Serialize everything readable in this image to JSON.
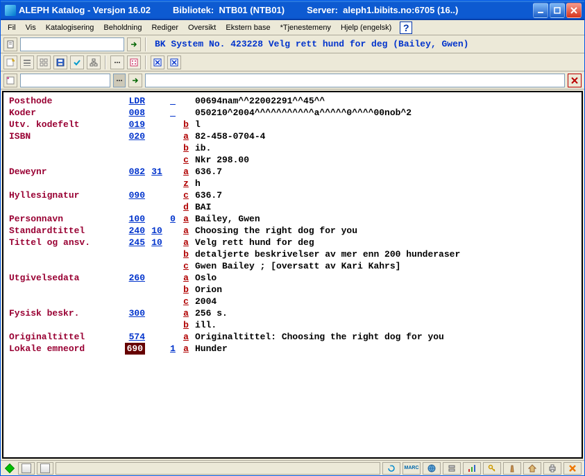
{
  "titlebar": {
    "app": "ALEPH Katalog - Versjon 16.02",
    "library_label": "Bibliotek:",
    "library_value": "NTB01 (NTB01)",
    "server_label": "Server:",
    "server_value": "aleph1.bibits.no:6705 (16..)"
  },
  "menu": {
    "fil": "Fil",
    "vis": "Vis",
    "katalogisering": "Katalogisering",
    "beholdning": "Beholdning",
    "rediger": "Rediger",
    "oversikt": "Oversikt",
    "eksternbase": "Ekstern base",
    "tjenestemeny": "*Tjenestemeny",
    "hjelp": "Hjelp (engelsk)"
  },
  "locbar": {
    "record_title": "BK System No. 423228 Velg rett hund for deg (Bailey, Gwen)"
  },
  "marc": [
    {
      "label": "Posthode",
      "tag": "LDR",
      "ind1": "",
      "ind2": "_",
      "sub": "",
      "val": "00694nam^^22002291^^45^^"
    },
    {
      "label": "Koder",
      "tag": "008",
      "ind1": "",
      "ind2": "_",
      "sub": "",
      "val": "050210^2004^^^^^^^^^^^a^^^^^0^^^^00nob^2"
    },
    {
      "label": "Utv. kodefelt",
      "tag": "019",
      "ind1": "",
      "ind2": "",
      "sub": "b",
      "val": "l"
    },
    {
      "label": "ISBN",
      "tag": "020",
      "ind1": "",
      "ind2": "",
      "sub": "a",
      "val": "82-458-0704-4"
    },
    {
      "label": "",
      "tag": "",
      "ind1": "",
      "ind2": "",
      "sub": "b",
      "val": "ib."
    },
    {
      "label": "",
      "tag": "",
      "ind1": "",
      "ind2": "",
      "sub": "c",
      "val": "Nkr 298.00"
    },
    {
      "label": "Deweynr",
      "tag": "082",
      "ind1": "31",
      "ind2": "",
      "sub": "a",
      "val": "636.7"
    },
    {
      "label": "",
      "tag": "",
      "ind1": "",
      "ind2": "",
      "sub": "z",
      "val": "h"
    },
    {
      "label": "Hyllesignatur",
      "tag": "090",
      "ind1": "",
      "ind2": "",
      "sub": "c",
      "val": "636.7"
    },
    {
      "label": "",
      "tag": "",
      "ind1": "",
      "ind2": "",
      "sub": "d",
      "val": "BAI"
    },
    {
      "label": "Personnavn",
      "tag": "100",
      "ind1": "",
      "ind2": "0",
      "sub": "a",
      "val": "Bailey, Gwen"
    },
    {
      "label": "Standardtittel",
      "tag": "240",
      "ind1": "10",
      "ind2": "",
      "sub": "a",
      "val": "Choosing the right dog for you"
    },
    {
      "label": "Tittel og ansv.",
      "tag": "245",
      "ind1": "10",
      "ind2": "",
      "sub": "a",
      "val": "Velg rett hund for deg"
    },
    {
      "label": "",
      "tag": "",
      "ind1": "",
      "ind2": "",
      "sub": "b",
      "val": "detaljerte beskrivelser av mer enn 200 hunderaser"
    },
    {
      "label": "",
      "tag": "",
      "ind1": "",
      "ind2": "",
      "sub": "c",
      "val": "Gwen Bailey ; [oversatt av Kari Kahrs]"
    },
    {
      "label": "Utgivelsedata",
      "tag": "260",
      "ind1": "",
      "ind2": "",
      "sub": "a",
      "val": "Oslo"
    },
    {
      "label": "",
      "tag": "",
      "ind1": "",
      "ind2": "",
      "sub": "b",
      "val": "Orion"
    },
    {
      "label": "",
      "tag": "",
      "ind1": "",
      "ind2": "",
      "sub": "c",
      "val": "2004"
    },
    {
      "label": "Fysisk beskr.",
      "tag": "300",
      "ind1": "",
      "ind2": "",
      "sub": "a",
      "val": "256 s."
    },
    {
      "label": "",
      "tag": "",
      "ind1": "",
      "ind2": "",
      "sub": "b",
      "val": "ill."
    },
    {
      "label": "Originaltittel",
      "tag": "574",
      "ind1": "",
      "ind2": "",
      "sub": "a",
      "val": "Originaltittel: Choosing the right dog for you"
    },
    {
      "label": "Lokale emneord",
      "tag": "690",
      "ind1": "",
      "ind2": "1",
      "sub": "a",
      "val": "Hunder",
      "selected": true
    }
  ]
}
